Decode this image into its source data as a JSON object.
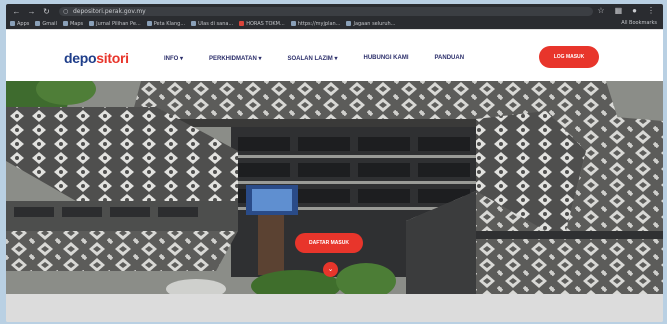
{
  "browser": {
    "url": "depositori.perak.gov.my",
    "bookmarks": [
      "Apps",
      "Gmail",
      "Maps",
      "Jurnal Pilihan Pe...",
      "Peta Klang...",
      "Ulas di sana...",
      "HORAS TOKM...",
      "https://myjplan...",
      "Jagaan seluruh..."
    ],
    "all_bookmarks": "All Bookmarks"
  },
  "site": {
    "logo_part1": "depo",
    "logo_part2": "sitori",
    "menu": [
      "INFO ▾",
      "PERKHIDMATAN ▾",
      "SOALAN LAZIM ▾",
      "HUBUNGI KAMI",
      "PANDUAN"
    ],
    "cta": "LOG MASUK",
    "brand_red": "#e8352b",
    "brand_navy": "#1f3e8a"
  },
  "hero": {
    "button": "DAFTAR MASUK",
    "down_icon": "chevron-down-icon"
  }
}
